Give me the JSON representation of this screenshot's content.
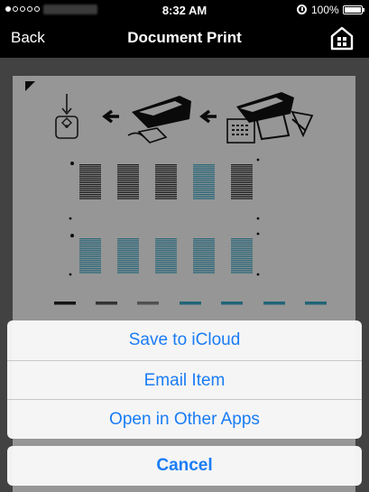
{
  "status_bar": {
    "time": "8:32 AM",
    "battery": "100%",
    "icons": [
      "signal-dots",
      "alarm-icon",
      "battery-icon"
    ]
  },
  "nav": {
    "back_label": "Back",
    "title": "Document Print",
    "right_icon": "home-icon"
  },
  "document": {
    "illustration_icons": [
      "touch-button-icon",
      "arrow-left-icon",
      "printer-open-icon",
      "arrow-left-icon",
      "printer-scanner-icon"
    ]
  },
  "action_sheet": {
    "items": [
      {
        "label": "Save to iCloud"
      },
      {
        "label": "Email Item"
      },
      {
        "label": "Open in Other Apps"
      }
    ],
    "cancel_label": "Cancel"
  },
  "colors": {
    "accent": "#1a7cf5",
    "cyan_ink": "#3aa9c6",
    "dark_ink": "#222222"
  }
}
